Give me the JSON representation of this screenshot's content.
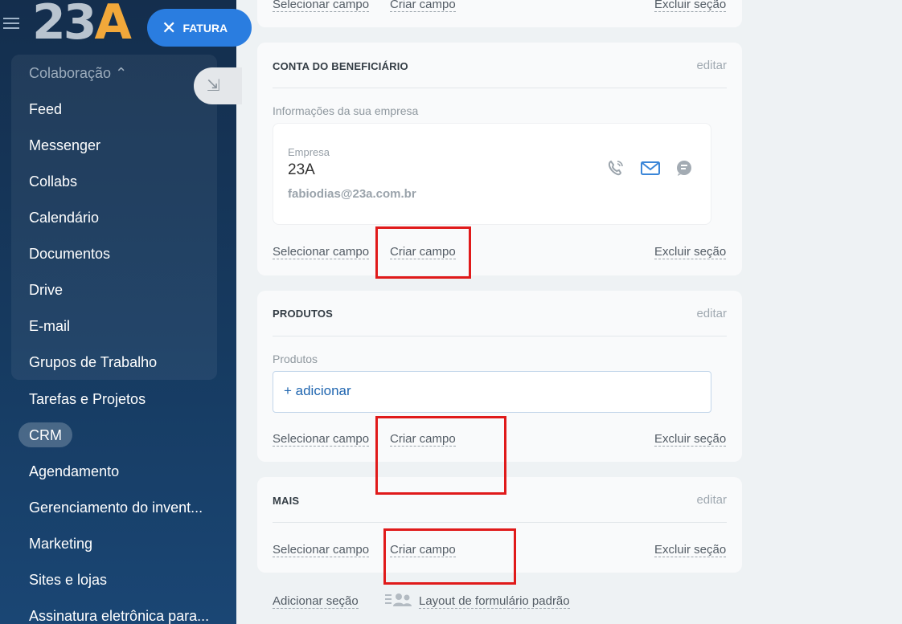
{
  "sidebar": {
    "logo": {
      "text_main": "23",
      "text_accent": "A"
    },
    "group_header": "Colaboração ⌃",
    "items": [
      "Feed",
      "Messenger",
      "Collabs",
      "Calendário",
      "Documentos",
      "Drive",
      "E-mail",
      "Grupos de Trabalho",
      "Tarefas e Projetos",
      "CRM",
      "Agendamento",
      "Gerenciamento do invent...",
      "Marketing",
      "Sites e lojas",
      "Assinatura eletrônica para..."
    ]
  },
  "header": {
    "tab_label": "FATURA",
    "close_glyph": "✕",
    "collapse_glyph": "⇲"
  },
  "sections": {
    "top_partial": {
      "select": "Selecionar campo",
      "create": "Criar campo",
      "delete": "Excluir seção"
    },
    "conta": {
      "title": "CONTA DO BENEFICIÁRIO",
      "edit": "editar",
      "sublabel": "Informações da sua empresa",
      "company_label": "Empresa",
      "company_name": "23A",
      "company_email": "fabiodias@23a.com.br",
      "icons": [
        "phone-icon",
        "mail-icon",
        "chat-icon"
      ],
      "select": "Selecionar campo",
      "create": "Criar campo",
      "delete": "Excluir seção"
    },
    "produtos": {
      "title": "PRODUTOS",
      "edit": "editar",
      "sublabel": "Produtos",
      "add": "+ adicionar",
      "select": "Selecionar campo",
      "create": "Criar campo",
      "delete": "Excluir seção"
    },
    "mais": {
      "title": "MAIS",
      "edit": "editar",
      "select": "Selecionar campo",
      "create": "Criar campo",
      "delete": "Excluir seção"
    }
  },
  "bottom": {
    "add_section": "Adicionar seção",
    "default_layout": "Layout de formulário padrão"
  },
  "colors": {
    "accent": "#2a7de0",
    "highlight": "#e01a1a"
  }
}
